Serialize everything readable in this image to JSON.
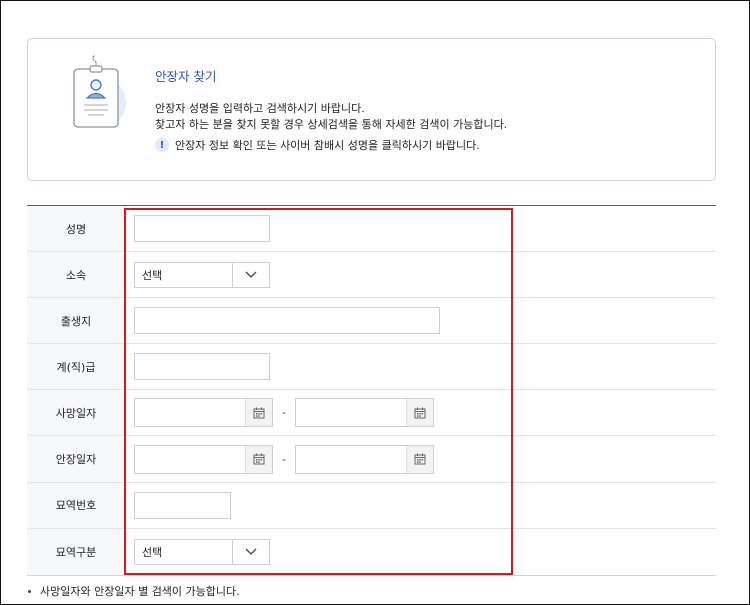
{
  "info": {
    "title": "안장자 찾기",
    "desc_line1": "안장자 성명을 입력하고 검색하시기 바랍니다.",
    "desc_line2": "찾고자 하는 분을 찾지 못할 경우 상세검색을 통해 자세한 검색이 가능합니다.",
    "note_icon": "!",
    "note": "안장자 정보 확인 또는 사이버 참배시 성명을 클릭하시기 바랍니다."
  },
  "form": {
    "name_label": "성명",
    "name_value": "",
    "affiliation_label": "소속",
    "affiliation_selected": "선택",
    "birthplace_label": "출생지",
    "birthplace_value": "",
    "rank_label": "계(직)급",
    "rank_value": "",
    "death_date_label": "사망일자",
    "death_date_from": "",
    "death_date_to": "",
    "burial_date_label": "안장일자",
    "burial_date_from": "",
    "burial_date_to": "",
    "date_separator": "-",
    "grave_no_label": "묘역번호",
    "grave_no_value": "",
    "grave_type_label": "묘역구분",
    "grave_type_selected": "선택"
  },
  "footer": {
    "note": "사망일자와 안장일자 별 검색이 가능합니다."
  },
  "icons": {
    "badge": "id-badge-illustration",
    "calendar": "calendar-icon",
    "chevron": "chevron-down-icon"
  },
  "colors": {
    "accent": "#2a56b8",
    "highlight": "#d7191f",
    "table_header": "#4a5a78"
  }
}
